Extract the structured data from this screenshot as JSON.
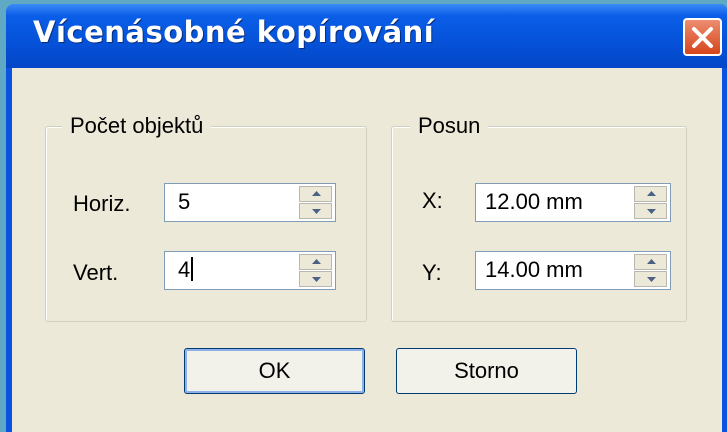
{
  "window": {
    "title": "Vícenásobné kopírování",
    "close_icon": "close-icon"
  },
  "count_group": {
    "label": "Počet objektů",
    "horiz": {
      "label": "Horiz.",
      "value": "5"
    },
    "vert": {
      "label": "Vert.",
      "value": "4"
    }
  },
  "offset_group": {
    "label": "Posun",
    "x": {
      "label": "X:",
      "value": "12.00 mm"
    },
    "y": {
      "label": "Y:",
      "value": "14.00 mm"
    }
  },
  "buttons": {
    "ok": "OK",
    "cancel": "Storno"
  }
}
